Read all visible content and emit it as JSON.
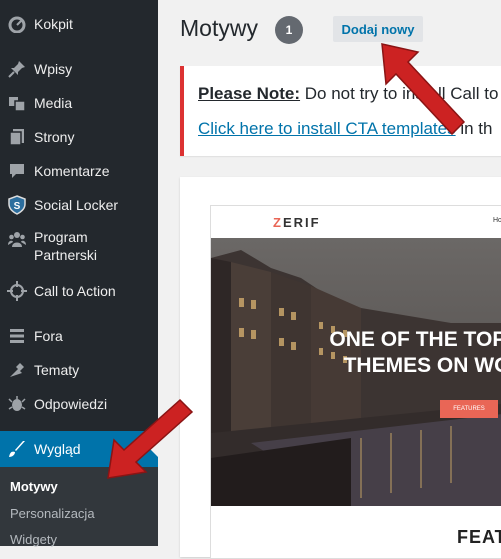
{
  "sidebar": {
    "items": [
      {
        "label": "Kokpit",
        "icon": "dashboard-icon"
      },
      {
        "label": "Wpisy",
        "icon": "pin-icon"
      },
      {
        "label": "Media",
        "icon": "media-icon"
      },
      {
        "label": "Strony",
        "icon": "pages-icon"
      },
      {
        "label": "Komentarze",
        "icon": "comments-icon"
      },
      {
        "label": "Social Locker",
        "icon": "shield-icon"
      },
      {
        "label": "Program Partnerski",
        "icon": "groups-icon"
      },
      {
        "label": "Call to Action",
        "icon": "crosshair-icon"
      },
      {
        "label": "Fora",
        "icon": "forums-icon"
      },
      {
        "label": "Tematy",
        "icon": "topics-icon"
      },
      {
        "label": "Odpowiedzi",
        "icon": "replies-icon"
      },
      {
        "label": "Wygląd",
        "icon": "brush-icon"
      }
    ],
    "submenu": [
      {
        "label": "Motywy"
      },
      {
        "label": "Personalizacja"
      },
      {
        "label": "Widgety"
      }
    ]
  },
  "header": {
    "title": "Motywy",
    "count": "1",
    "add_new": "Dodaj nowy"
  },
  "notice": {
    "strong": "Please Note:",
    "text": " Do not try to install Call to",
    "link": "Click here to install CTA templates",
    "link_suffix": " in th"
  },
  "theme_preview": {
    "logo_accent": "Z",
    "logo_rest": "ERIF",
    "nav_link": "Ho",
    "hero_line1": "ONE OF THE TOP T",
    "hero_line2": "THEMES ON WO",
    "button": "FEATURES",
    "section_title": "FEAT"
  },
  "colors": {
    "sidebar_bg": "#23282d",
    "active_bg": "#0073aa",
    "notice_border": "#dc3232",
    "arrow": "#cc2222",
    "zerif_accent": "#e96656"
  }
}
